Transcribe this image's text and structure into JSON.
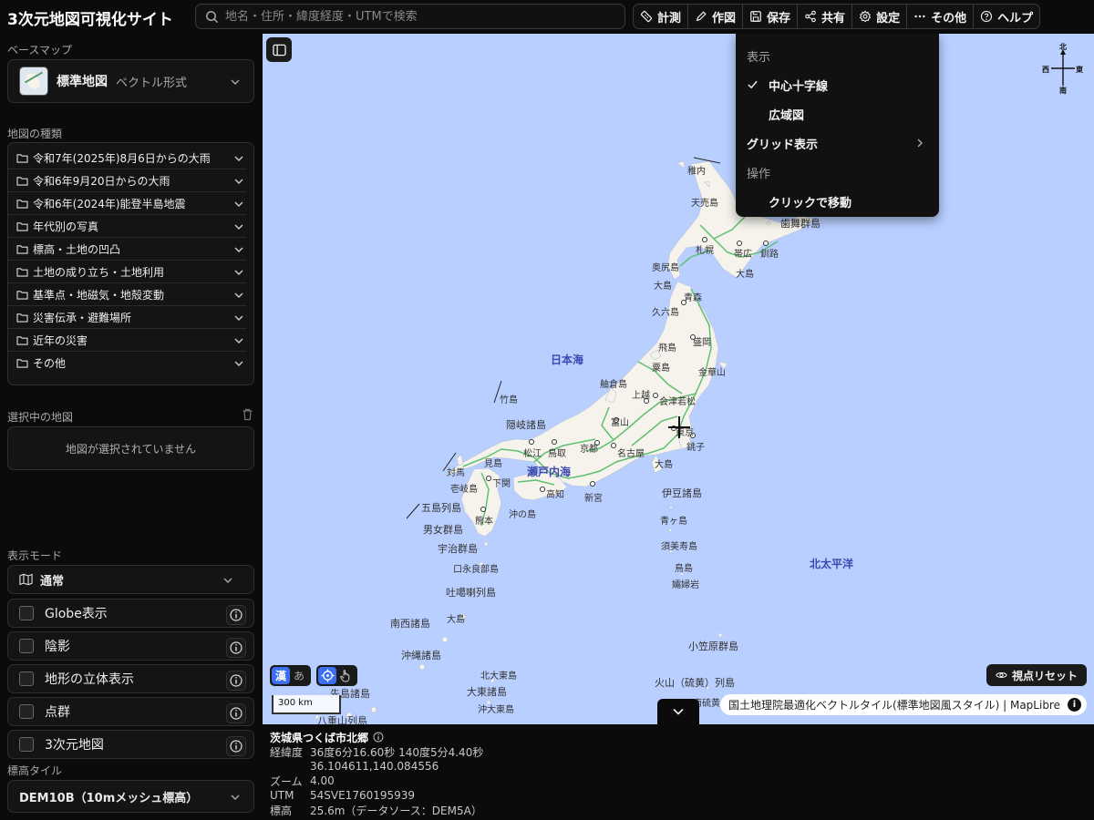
{
  "app": {
    "title": "3次元地図可視化サイト"
  },
  "search": {
    "placeholder": "地名・住所・緯度経度・UTMで検索"
  },
  "toolbar": {
    "measure": "計測",
    "draw": "作図",
    "save": "保存",
    "share": "共有",
    "settings": "設定",
    "more": "その他",
    "help": "ヘルプ"
  },
  "sidebar": {
    "basemap_label": "ベースマップ",
    "basemap_name": "標準地図",
    "basemap_format": "ベクトル形式",
    "maptypes_label": "地図の種類",
    "maptypes": [
      "令和7年(2025年)8月6日からの大雨",
      "令和6年9月20日からの大雨",
      "令和6年(2024年)能登半島地震",
      "年代別の写真",
      "標高・土地の凹凸",
      "土地の成り立ち・土地利用",
      "基準点・地磁気・地殻変動",
      "災害伝承・避難場所",
      "近年の災害",
      "その他"
    ],
    "selected_label": "選択中の地図",
    "selected_empty": "地図が選択されていません",
    "mode_label": "表示モード",
    "mode_value": "通常",
    "checks": [
      "Globe表示",
      "陰影",
      "地形の立体表示",
      "点群",
      "3次元地図"
    ],
    "elev_label": "標高タイル",
    "elev_value": "DEM10B（10mメッシュ標高）"
  },
  "menu": {
    "display_header": "表示",
    "center_cross": "中心十字線",
    "overview": "広域図",
    "grid": "グリッド表示",
    "operation_header": "操作",
    "click_move": "クリックで移動"
  },
  "map": {
    "compass": {
      "n": "北",
      "s": "南",
      "w": "西",
      "e": "東"
    },
    "seas": {
      "japan_sea": "日本海",
      "setonaikai": "瀬戸内海",
      "pacific": "北太平洋"
    },
    "places": {
      "wakkanai": "稚内",
      "teshio": "天売島",
      "sapporo": "札幌",
      "obihiro": "帯広",
      "kushiro": "釧路",
      "habomai": "歯舞群島",
      "okushiri": "奥尻島",
      "oshima": "大島",
      "aomori": "青森",
      "kuji": "久六島",
      "morioka": "盛岡",
      "tobishima": "飛島",
      "sado": "粟島",
      "kinkasan": "金華山",
      "hegura": "舳倉島",
      "joetsu": "上越",
      "aizu": "会津若松",
      "tokyo": "東京",
      "choshi": "銚子",
      "toyama": "富山",
      "kyoto": "京都",
      "nagoya": "名古屋",
      "oshima2": "大島",
      "matsue": "松江",
      "tottori": "鳥取",
      "takeshima": "竹島",
      "oki": "隠岐諸島",
      "mishima": "見島",
      "tsushima": "対馬",
      "shimonoseki": "下関",
      "iki": "壱岐島",
      "kochi": "高知",
      "shingu": "新宮",
      "kumamoto": "熊本",
      "okinoshima": "沖の島",
      "goto": "五島列島",
      "danjo": "男女群島",
      "uji": "宇治群島",
      "kuchinoerabu": "口永良部島",
      "tokara": "吐噶喇列島",
      "amami": "大島",
      "nansei": "南西諸島",
      "okinawa": "沖縄諸島",
      "sakishima": "先島諸島",
      "yaeyama": "八重山列島",
      "kitadaito": "北大東島",
      "daito": "大東諸島",
      "minamidaito": "沖大東島",
      "izu": "伊豆諸島",
      "aogashima": "青ヶ島",
      "sumisu": "須美寿島",
      "torishima": "鳥島",
      "sofugan": "孀婦岩",
      "ogasawara": "小笠原群島",
      "kazan": "火山（硫黄）列島",
      "minamiiwo": "南硫黄島"
    },
    "lang_on": "漢",
    "lang_off": "あ",
    "scale": "300 km",
    "reset_label": "視点リセット",
    "attribution": "国土地理院最適化ベクトルタイル(標準地図風スタイル) | MapLibre",
    "attrib_info": "i"
  },
  "info": {
    "location": "茨城県つくば市北郷",
    "rows": {
      "latlon_key": "経緯度",
      "latlon_dms": "36度6分16.60秒 140度5分4.40秒",
      "latlon_dec": "36.104611,140.084556",
      "zoom_key": "ズーム",
      "zoom": "4.00",
      "utm_key": "UTM",
      "utm": "54SVE1760195939",
      "elev_key": "標高",
      "elev": "25.6m（データソース：DEM5A）"
    }
  },
  "colors": {
    "sea": "#b9cfff",
    "land": "#f5f3ec",
    "road": "#5fc070",
    "accent": "#3b6ff0"
  }
}
